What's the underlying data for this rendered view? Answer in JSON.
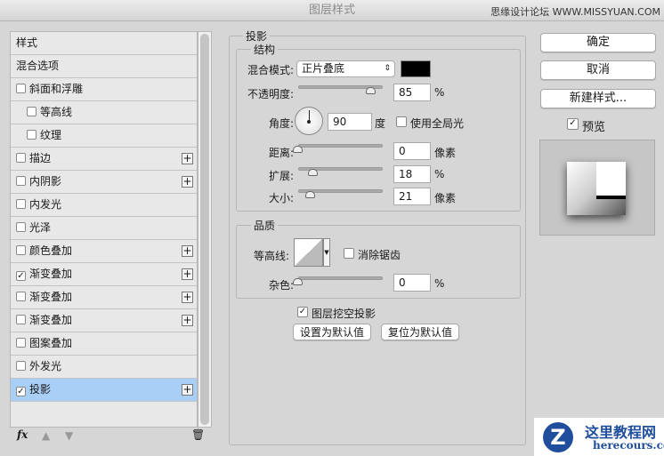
{
  "window": {
    "title": "图层样式",
    "watermark": "思缘设计论坛 WWW.MISSYUAN.COM"
  },
  "sidebar": {
    "items": [
      {
        "label": "样式",
        "checkbox": false,
        "checked": false,
        "plus": false,
        "indent": false
      },
      {
        "label": "混合选项",
        "checkbox": false,
        "checked": false,
        "plus": false,
        "indent": false
      },
      {
        "label": "斜面和浮雕",
        "checkbox": true,
        "checked": false,
        "plus": false,
        "indent": false
      },
      {
        "label": "等高线",
        "checkbox": true,
        "checked": false,
        "plus": false,
        "indent": true
      },
      {
        "label": "纹理",
        "checkbox": true,
        "checked": false,
        "plus": false,
        "indent": true
      },
      {
        "label": "描边",
        "checkbox": true,
        "checked": false,
        "plus": true,
        "indent": false
      },
      {
        "label": "内阴影",
        "checkbox": true,
        "checked": false,
        "plus": true,
        "indent": false
      },
      {
        "label": "内发光",
        "checkbox": true,
        "checked": false,
        "plus": false,
        "indent": false
      },
      {
        "label": "光泽",
        "checkbox": true,
        "checked": false,
        "plus": false,
        "indent": false
      },
      {
        "label": "颜色叠加",
        "checkbox": true,
        "checked": false,
        "plus": true,
        "indent": false
      },
      {
        "label": "渐变叠加",
        "checkbox": true,
        "checked": true,
        "plus": true,
        "indent": false
      },
      {
        "label": "渐变叠加",
        "checkbox": true,
        "checked": false,
        "plus": true,
        "indent": false
      },
      {
        "label": "渐变叠加",
        "checkbox": true,
        "checked": false,
        "plus": true,
        "indent": false
      },
      {
        "label": "图案叠加",
        "checkbox": true,
        "checked": false,
        "plus": false,
        "indent": false
      },
      {
        "label": "外发光",
        "checkbox": true,
        "checked": false,
        "plus": false,
        "indent": false
      },
      {
        "label": "投影",
        "checkbox": true,
        "checked": true,
        "plus": true,
        "indent": false,
        "selected": true
      }
    ],
    "fx_label": "fx"
  },
  "panel": {
    "title": "投影",
    "structure": {
      "title": "结构",
      "blend_mode_label": "混合模式:",
      "blend_mode": "正片叠底",
      "color": "#000000",
      "opacity_label": "不透明度:",
      "opacity": "85",
      "opacity_unit": "%",
      "opacity_pct": 85,
      "angle_label": "角度:",
      "angle": "90",
      "angle_unit": "度",
      "global_light_label": "使用全局光",
      "global_light": false,
      "distance_label": "距离:",
      "distance": "0",
      "distance_unit": "像素",
      "distance_pct": 0,
      "spread_label": "扩展:",
      "spread": "18",
      "spread_unit": "%",
      "spread_pct": 18,
      "size_label": "大小:",
      "size": "21",
      "size_unit": "像素",
      "size_pct": 15
    },
    "quality": {
      "title": "品质",
      "contour_label": "等高线:",
      "antialias_label": "消除锯齿",
      "noise_label": "杂色:",
      "noise": "0",
      "noise_unit": "%",
      "noise_pct": 0
    },
    "knockout_label": "图层挖空投影",
    "knockout": true,
    "set_default": "设置为默认值",
    "reset_default": "复位为默认值"
  },
  "actions": {
    "ok": "确定",
    "cancel": "取消",
    "new_style": "新建样式...",
    "preview_label": "预览",
    "preview": true
  },
  "logo": {
    "text": "这里教程网",
    "url": "herecours.com"
  }
}
